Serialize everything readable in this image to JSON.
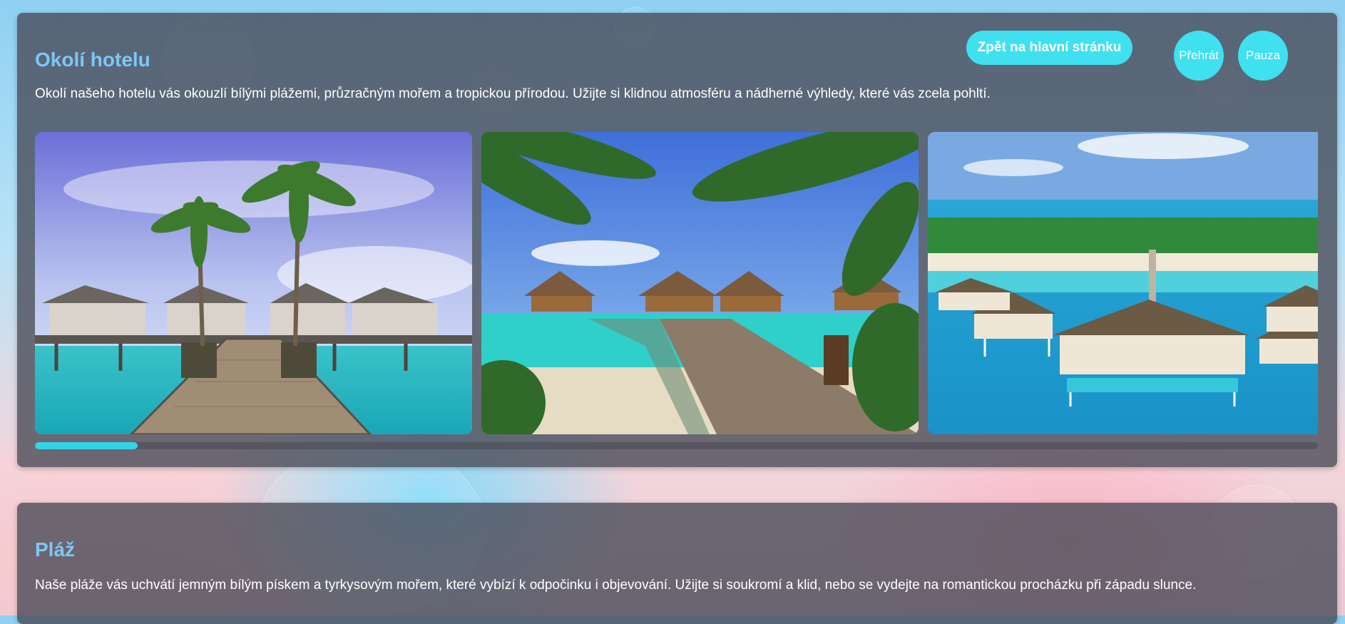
{
  "section1": {
    "title": "Okolí hotelu",
    "description": "Okolí našeho hotelu vás okouzlí bílými plážemi, průzračným mořem a tropickou přírodou. Užijte si klidnou atmosféru a nádherné výhledy, které vás zcela pohltí.",
    "back_button_label": "Zpět na hlavní stránku",
    "play_button_label": "Přehrát",
    "pause_button_label": "Pauza",
    "slideshow_progress": 0.08,
    "photos": [
      "overwater-villas-pier-photo",
      "beach-palms-pier-photo",
      "aerial-resort-island-photo"
    ]
  },
  "section2": {
    "title": "Pláž",
    "description": "Naše pláže vás uchvátí jemným bílým pískem a tyrkysovým mořem, které vybízí k odpočinku i objevování. Užijte si soukromí a klid, nebo se vydejte na romantickou procházku při západu slunce."
  },
  "colors": {
    "accent": "#3fe0f0",
    "title": "#7cc8f5",
    "panel": "#46485a"
  }
}
